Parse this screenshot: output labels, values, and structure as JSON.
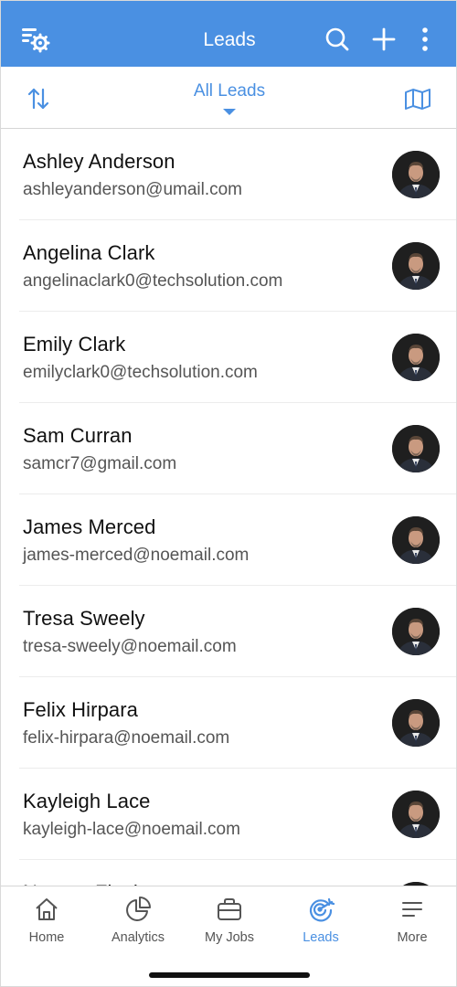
{
  "header": {
    "title": "Leads",
    "settings_icon": "filter-settings-icon",
    "search_icon": "search-icon",
    "add_icon": "plus-icon",
    "more_icon": "more-vertical-icon"
  },
  "subbar": {
    "sort_icon": "sort-arrows-icon",
    "filter_label": "All Leads",
    "map_icon": "map-icon"
  },
  "leads": [
    {
      "name": "Ashley Anderson",
      "email": "ashleyanderson@umail.com"
    },
    {
      "name": "Angelina Clark",
      "email": "angelinaclark0@techsolution.com"
    },
    {
      "name": "Emily Clark",
      "email": "emilyclark0@techsolution.com"
    },
    {
      "name": "Sam Curran",
      "email": "samcr7@gmail.com"
    },
    {
      "name": "James Merced",
      "email": "james-merced@noemail.com"
    },
    {
      "name": "Tresa Sweely",
      "email": "tresa-sweely@noemail.com"
    },
    {
      "name": "Felix Hirpara",
      "email": "felix-hirpara@noemail.com"
    },
    {
      "name": "Kayleigh Lace",
      "email": "kayleigh-lace@noemail.com"
    },
    {
      "name": "Noreen Finch",
      "email": ""
    }
  ],
  "tabs": [
    {
      "label": "Home",
      "icon": "home-icon"
    },
    {
      "label": "Analytics",
      "icon": "pie-chart-icon"
    },
    {
      "label": "My Jobs",
      "icon": "briefcase-icon"
    },
    {
      "label": "Leads",
      "icon": "target-icon"
    },
    {
      "label": "More",
      "icon": "menu-lines-icon"
    }
  ],
  "colors": {
    "accent": "#4a90e2",
    "header_bg": "#4a90e2",
    "text_primary": "#111111",
    "text_secondary": "#555555"
  }
}
